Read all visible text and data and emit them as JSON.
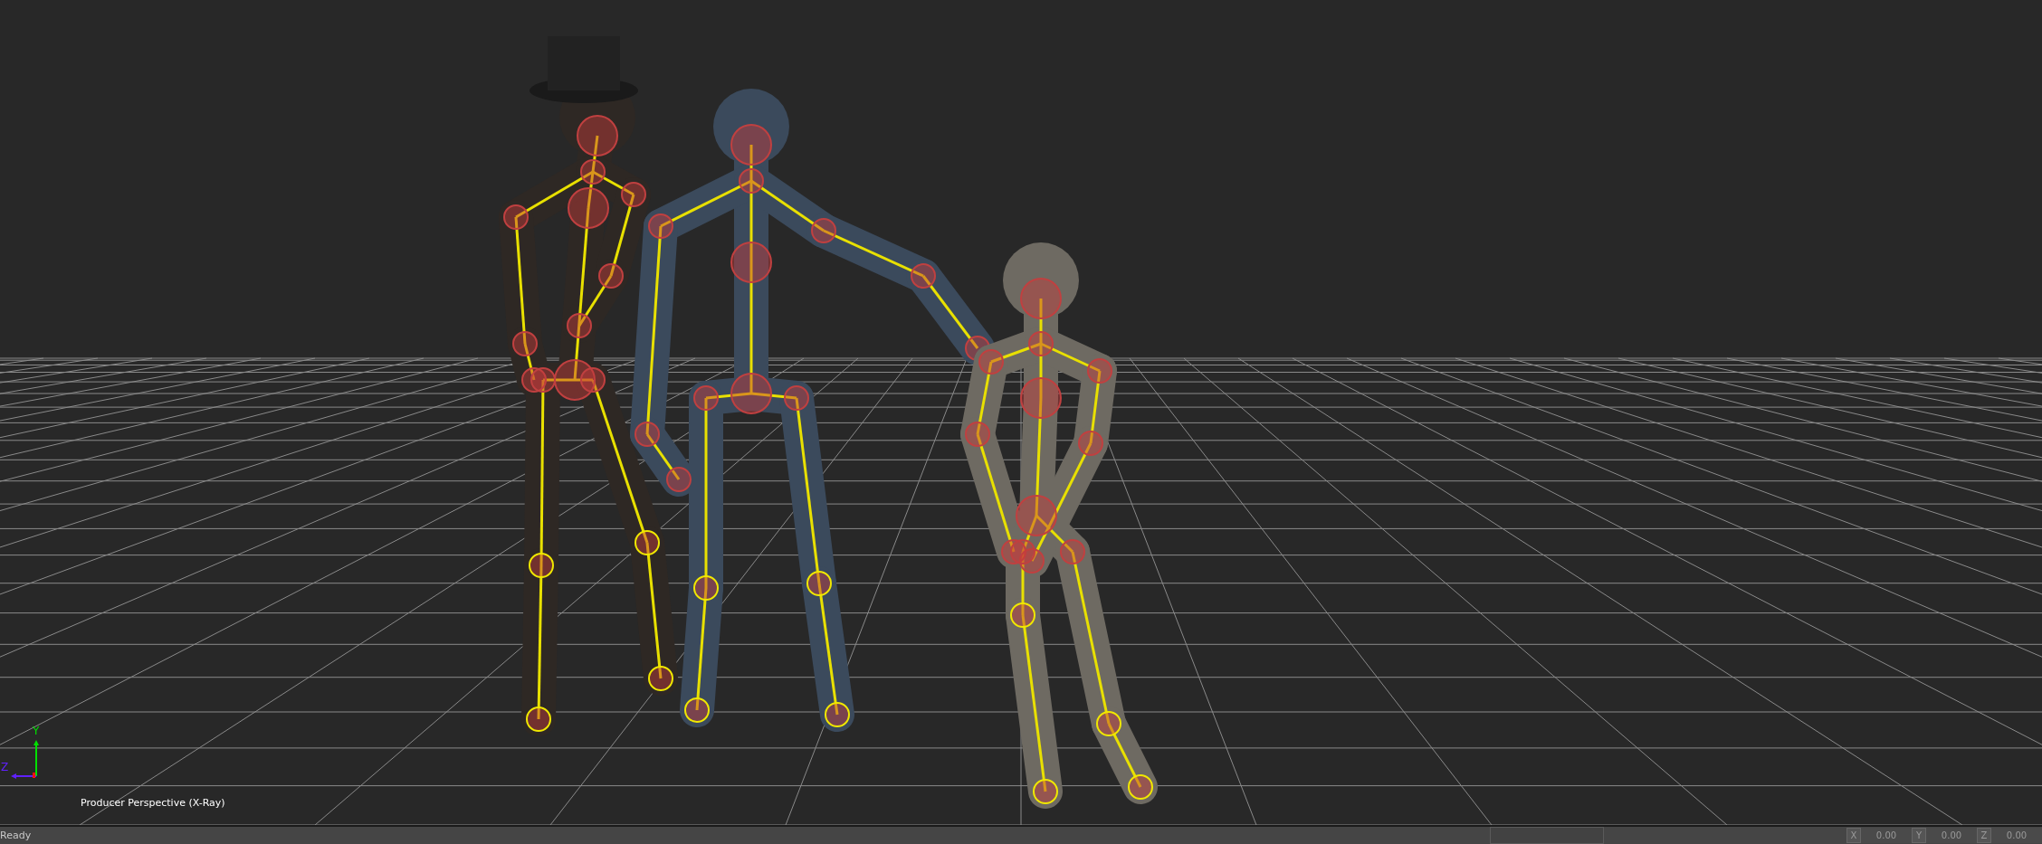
{
  "viewport": {
    "label": "Producer Perspective (X-Ray)",
    "axis_labels": [
      "Y",
      "Z"
    ]
  },
  "status_bar": {
    "message": "Ready",
    "coordinates": [
      {
        "axis": "X",
        "value": "0.00"
      },
      {
        "axis": "Y",
        "value": "0.00"
      },
      {
        "axis": "Z",
        "value": "0.00"
      }
    ]
  }
}
